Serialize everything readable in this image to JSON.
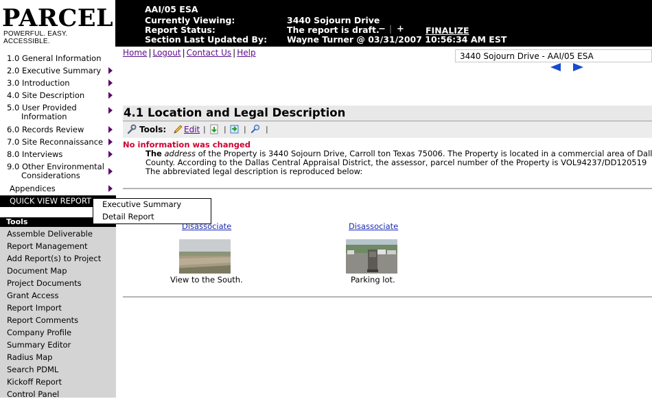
{
  "logo": {
    "title": "PARCEL",
    "tagline": "POWERFUL. EASY. ACCESSIBLE."
  },
  "header": {
    "project_name": "AAI/05 ESA",
    "viewing_label": "Currently Viewing:",
    "viewing_value": "3440 Sojourn Drive",
    "status_label": "Report Status:",
    "status_value": "The report is draft.",
    "minus": "−",
    "sep": "|",
    "plus": "+",
    "finalize": "FINALIZE",
    "updated_label": "Section Last Updated By:",
    "updated_value": "Wayne Turner @ 03/31/2007 10:56:34 AM EST"
  },
  "sidebar": {
    "sections": [
      {
        "label": "1.0 General Information",
        "arrow": false
      },
      {
        "label": "2.0 Executive Summary",
        "arrow": true
      },
      {
        "label": "3.0 Introduction",
        "arrow": true
      },
      {
        "label": "4.0 Site Description",
        "arrow": true
      },
      {
        "label": "5.0 User Provided",
        "label2": "Information",
        "arrow": true
      },
      {
        "label": "6.0 Records Review",
        "arrow": true
      },
      {
        "label": "7.0 Site Reconnaissance",
        "arrow": true
      },
      {
        "label": "8.0 Interviews",
        "arrow": true
      },
      {
        "label": "9.0 Other Environmental",
        "label2": "Considerations",
        "arrow": true
      },
      {
        "label": "Appendices",
        "arrow": true
      }
    ],
    "quick_view": "QUICK VIEW REPORT",
    "quick_view_options": [
      "Executive Summary",
      "Detail Report"
    ],
    "tools_title": "Tools",
    "tools": [
      "Assemble Deliverable",
      "Report Management",
      "Add Report(s) to Project",
      "Document Map",
      "Project Documents",
      "Grant Access",
      "Report Import",
      "Report Comments",
      "Company Profile",
      "Summary Editor",
      "Radius Map",
      "Search PDML",
      "Kickoff Report",
      "Control Panel"
    ]
  },
  "toplinks": [
    "Home",
    "Logout",
    "Contact Us",
    "Help"
  ],
  "toplinks_sep": "|",
  "report_select": "3440 Sojourn Drive - AAI/05 ESA",
  "section": {
    "title": "4.1 Location and Legal Description",
    "tools_label": "Tools:",
    "edit": "Edit",
    "tb_sep": "|",
    "no_change": "No information was changed",
    "body_lead": "The",
    "body_italic": "address",
    "body_line1_rest": "of the Property is 3440 Sojourn Drive, Carroll ton Texas 75006. The Property is located in a commercial area of Dallas",
    "body_line2": "County.  According to the Dallas Central Appraisal District, the assessor,  parcel number of the Property is VOL94237/DD120519",
    "body_line3": "The abbreviated legal description is reproduced below:"
  },
  "photos": [
    {
      "link": "Disassociate",
      "caption": "View to the South."
    },
    {
      "link": "Disassociate",
      "caption": "Parking lot."
    }
  ],
  "colors": {
    "link_purple": "#5a0a8a",
    "alert_red": "#cc0033",
    "nav_arrow_blue": "#1a4ad0"
  }
}
